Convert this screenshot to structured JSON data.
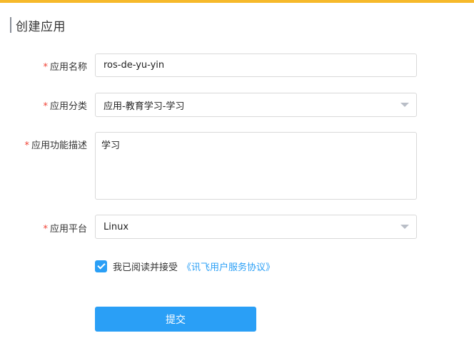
{
  "colors": {
    "top_bar": "#f6b92b",
    "primary": "#2a9ff6",
    "required": "#f04134",
    "link": "#2a9ff6"
  },
  "header": {
    "title": "创建应用"
  },
  "form": {
    "required_mark": "*",
    "app_name": {
      "label": "应用名称",
      "value": "ros-de-yu-yin"
    },
    "app_category": {
      "label": "应用分类",
      "selected": "应用-教育学习-学习",
      "icon": "chevron-down-icon"
    },
    "app_description": {
      "label": "应用功能描述",
      "value": "学习"
    },
    "app_platform": {
      "label": "应用平台",
      "selected": "Linux",
      "icon": "chevron-down-icon"
    },
    "agreement": {
      "checked": true,
      "text": "我已阅读并接受",
      "link_text": "《讯飞用户服务协议》"
    },
    "submit_label": "提交"
  }
}
